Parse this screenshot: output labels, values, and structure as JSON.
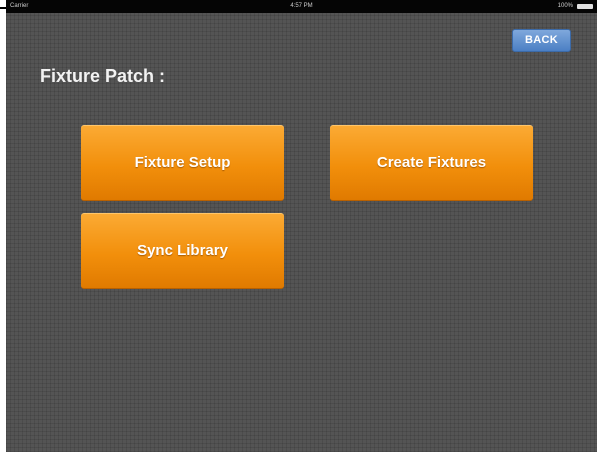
{
  "status_bar": {
    "carrier": "Carrier",
    "time": "4:57 PM",
    "battery": "100%"
  },
  "nav": {
    "back_label": "BACK"
  },
  "page": {
    "title": "Fixture Patch :"
  },
  "buttons": {
    "fixture_setup": "Fixture Setup",
    "create_fixtures": "Create Fixtures",
    "sync_library": "Sync Library"
  },
  "colors": {
    "background": "#545454",
    "button_orange": "#f28f0b",
    "back_button_blue": "#5a8bd0",
    "status_bar": "#050505"
  }
}
